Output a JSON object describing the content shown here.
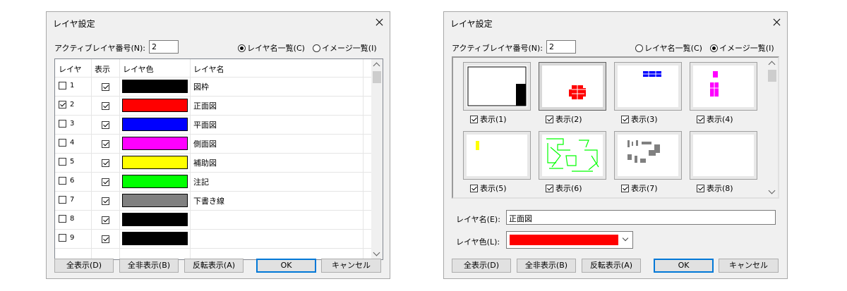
{
  "listDialog": {
    "title": "レイヤ設定",
    "active_label": "アクティブレイヤ番号(N):",
    "active_value": "2",
    "radio_list": "レイヤ名一覧(C)",
    "radio_image": "イメージ一覧(I)",
    "selected_view": "list",
    "columns": [
      "レイヤ",
      "表示",
      "レイヤ色",
      "レイヤ名"
    ],
    "rows": [
      {
        "num": "1",
        "selected": false,
        "visible": true,
        "color": "#000000",
        "name": "図枠"
      },
      {
        "num": "2",
        "selected": true,
        "visible": true,
        "color": "#ff0000",
        "name": "正面図"
      },
      {
        "num": "3",
        "selected": false,
        "visible": true,
        "color": "#0000ff",
        "name": "平面図"
      },
      {
        "num": "4",
        "selected": false,
        "visible": true,
        "color": "#ff00ff",
        "name": "側面図"
      },
      {
        "num": "5",
        "selected": false,
        "visible": true,
        "color": "#ffff00",
        "name": "補助図"
      },
      {
        "num": "6",
        "selected": false,
        "visible": true,
        "color": "#00ff00",
        "name": "注記"
      },
      {
        "num": "7",
        "selected": false,
        "visible": true,
        "color": "#808080",
        "name": "下書き線"
      },
      {
        "num": "8",
        "selected": false,
        "visible": true,
        "color": "#000000",
        "name": ""
      },
      {
        "num": "9",
        "selected": false,
        "visible": true,
        "color": "#000000",
        "name": ""
      }
    ],
    "buttons": {
      "show_all": "全表示(D)",
      "hide_all": "全非表示(B)",
      "invert": "反転表示(A)",
      "ok": "OK",
      "cancel": "キャンセル"
    }
  },
  "imageDialog": {
    "title": "レイヤ設定",
    "active_label": "アクティブレイヤ番号(N):",
    "active_value": "2",
    "radio_list": "レイヤ名一覧(C)",
    "radio_image": "イメージ一覧(I)",
    "selected_view": "image",
    "tiles": [
      {
        "label": "表示(1)",
        "checked": true,
        "color": "#000000",
        "kind": "frame"
      },
      {
        "label": "表示(2)",
        "checked": true,
        "color": "#ff0000",
        "kind": "front"
      },
      {
        "label": "表示(3)",
        "checked": true,
        "color": "#0000ff",
        "kind": "plan"
      },
      {
        "label": "表示(4)",
        "checked": true,
        "color": "#ff00ff",
        "kind": "side"
      },
      {
        "label": "表示(5)",
        "checked": true,
        "color": "#ffff00",
        "kind": "aux"
      },
      {
        "label": "表示(6)",
        "checked": true,
        "color": "#00ff00",
        "kind": "note"
      },
      {
        "label": "表示(7)",
        "checked": true,
        "color": "#808080",
        "kind": "draft"
      },
      {
        "label": "表示(8)",
        "checked": true,
        "color": "#ffffff",
        "kind": "empty"
      }
    ],
    "name_label": "レイヤ名(E):",
    "name_value": "正面図",
    "color_label": "レイヤ色(L):",
    "color_value": "#ff0000",
    "buttons": {
      "show_all": "全表示(D)",
      "hide_all": "全非表示(B)",
      "invert": "反転表示(A)",
      "ok": "OK",
      "cancel": "キャンセル"
    }
  }
}
